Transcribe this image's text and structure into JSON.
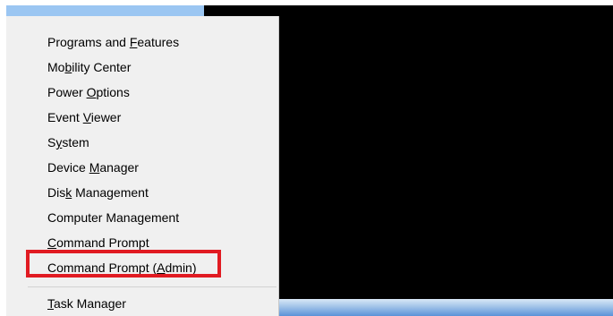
{
  "menu": {
    "items": [
      {
        "before": "Programs and ",
        "acc": "F",
        "after": "eatures"
      },
      {
        "before": "Mo",
        "acc": "b",
        "after": "ility Center"
      },
      {
        "before": "Power ",
        "acc": "O",
        "after": "ptions"
      },
      {
        "before": "Event ",
        "acc": "V",
        "after": "iewer"
      },
      {
        "before": "S",
        "acc": "y",
        "after": "stem"
      },
      {
        "before": "Device ",
        "acc": "M",
        "after": "anager"
      },
      {
        "before": "Dis",
        "acc": "k",
        "after": " Management"
      },
      {
        "before": "Computer Mana",
        "acc": "g",
        "after": "ement"
      },
      {
        "before": "",
        "acc": "C",
        "after": "ommand Prompt"
      },
      {
        "before": "Command Prompt (",
        "acc": "A",
        "after": "dmin)"
      },
      {
        "before": "",
        "acc": "T",
        "after": "ask Manager"
      }
    ]
  },
  "colors": {
    "highlight_border": "#e11b22",
    "menu_background": "#f0f0f0",
    "desktop_background": "#000000"
  }
}
